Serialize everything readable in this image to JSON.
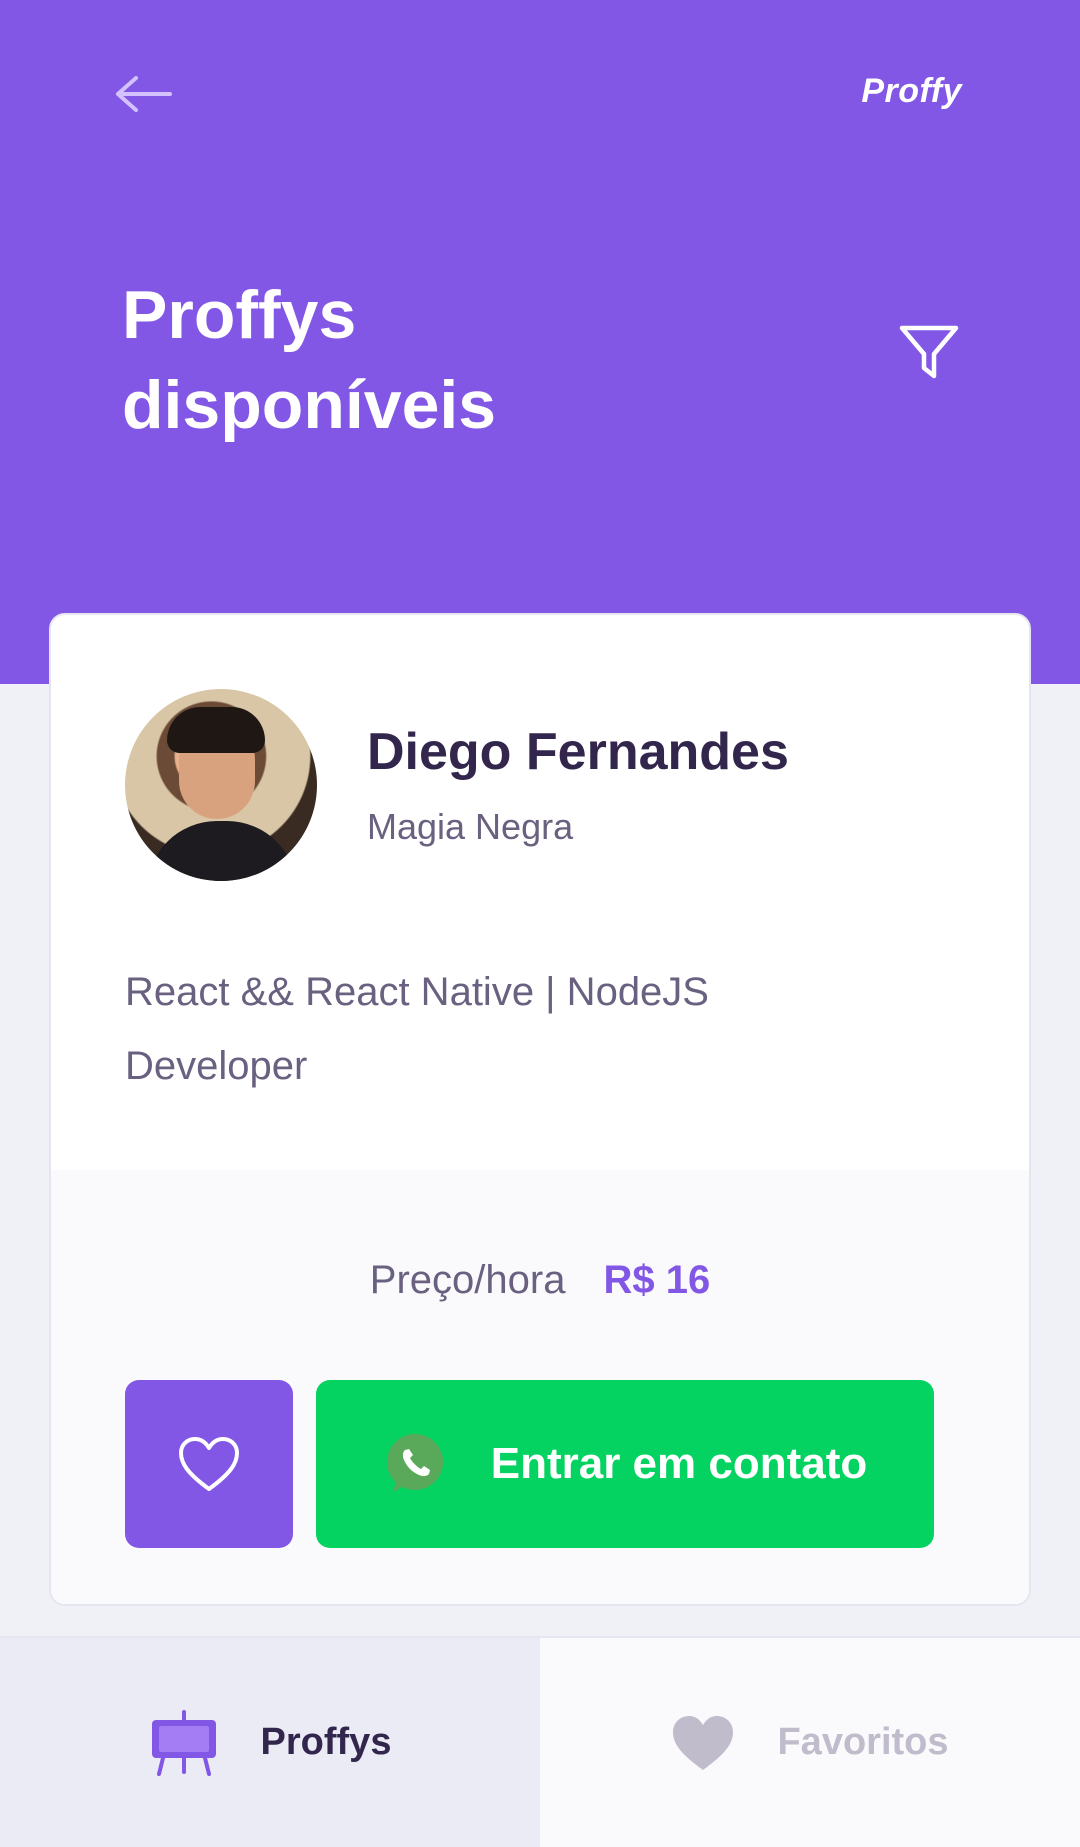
{
  "header": {
    "logo": "Proffy",
    "title_line1": "Proffys",
    "title_line2": "disponíveis"
  },
  "teacher": {
    "name": "Diego Fernandes",
    "subject": "Magia Negra",
    "bio_line1": "React && React Native | NodeJS",
    "bio_line2": "Developer",
    "price_label": "Preço/hora",
    "price_value": "R$ 16",
    "contact_label": "Entrar em contato"
  },
  "tabs": [
    {
      "label": "Proffys",
      "icon": "easel-icon",
      "active": true
    },
    {
      "label": "Favoritos",
      "icon": "heart-icon",
      "active": false
    }
  ],
  "colors": {
    "primary": "#8257e5",
    "whatsapp_green": "#04d361",
    "title_dark": "#32264d",
    "text_muted": "#6a6180",
    "inactive": "#c1bccc",
    "background": "#f0f0f7"
  }
}
